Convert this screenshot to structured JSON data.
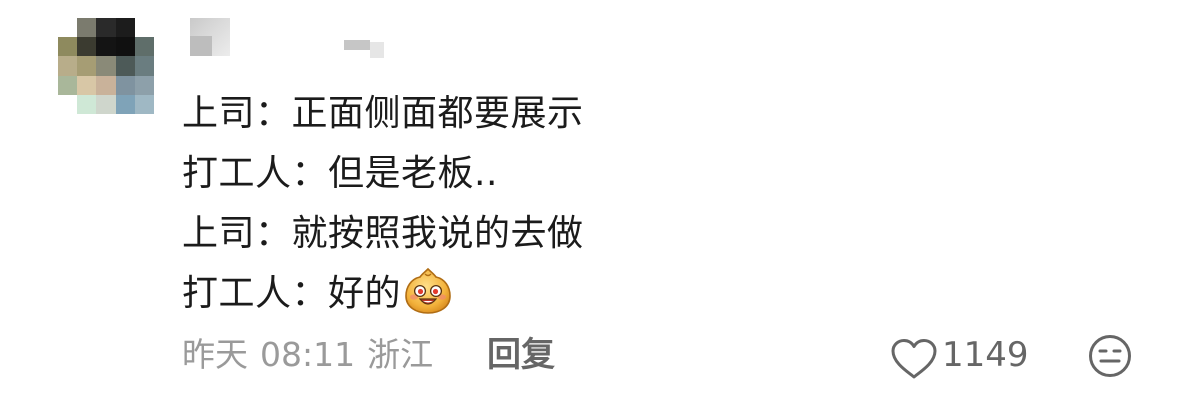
{
  "comment": {
    "lines": [
      {
        "speaker": "上司",
        "colon": "：",
        "text": "正面侧面都要展示"
      },
      {
        "speaker": "打工人",
        "colon": "：",
        "text": "但是老板.."
      },
      {
        "speaker": "上司",
        "colon": "：",
        "text": "就按照我说的去做"
      },
      {
        "speaker": "打工人",
        "colon": "：",
        "text": "好的",
        "emoji": "grinning-steamed-bun-emoji"
      }
    ],
    "meta": {
      "date": "昨天",
      "time": "08:11",
      "location": "浙江"
    },
    "reply_label": "回复",
    "like_count": "1149",
    "icons": {
      "like": "heart-outline-icon",
      "react": "neutral-face-icon"
    },
    "colors": {
      "text": "#1b1b1b",
      "meta": "#9a9a9a",
      "action": "#666666"
    }
  }
}
